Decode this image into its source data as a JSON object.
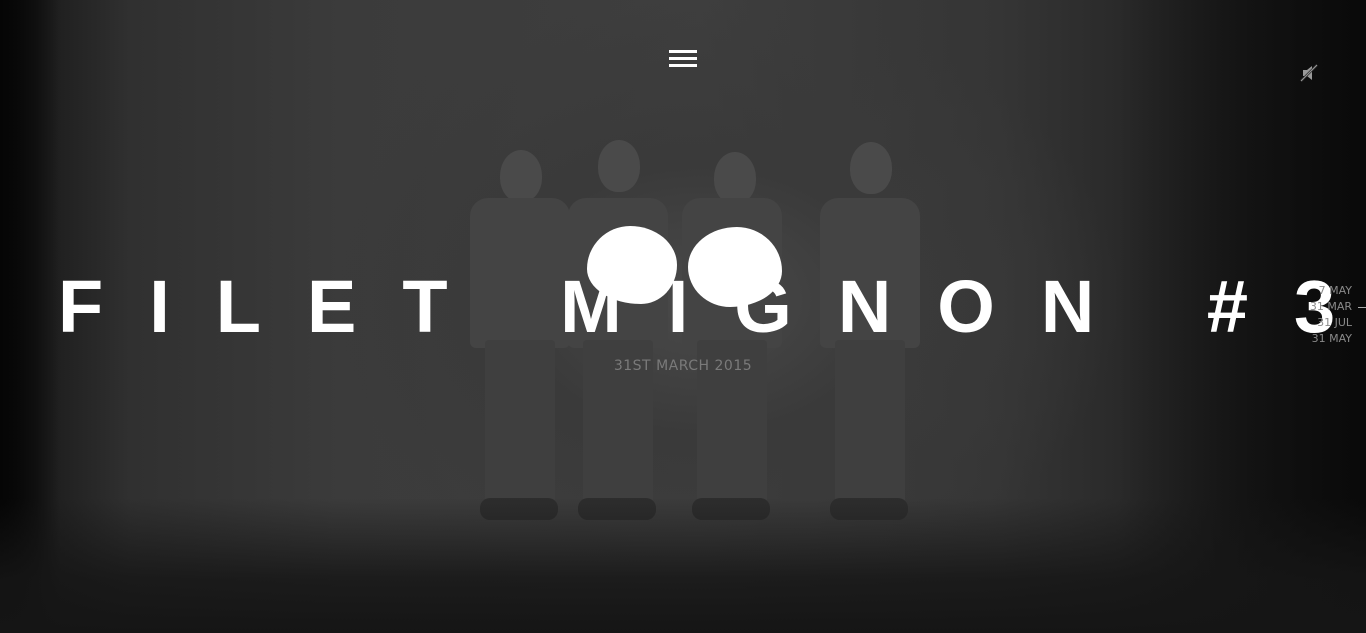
{
  "hero": {
    "title": "FILET MIGNON #3",
    "date": "31ST MARCH 2015"
  },
  "navigation": {
    "menu_icon": "hamburger-icon",
    "sound_icon": "speaker-muted-icon"
  },
  "timeline": {
    "items": [
      "7 MAY",
      "31 MAR",
      "31 JUL",
      "31 MAY"
    ]
  },
  "colors": {
    "text": "#ffffff",
    "background": "#2f2f2f",
    "date_text": "#7a7a7a",
    "timeline_text": "#8a8a8a"
  }
}
